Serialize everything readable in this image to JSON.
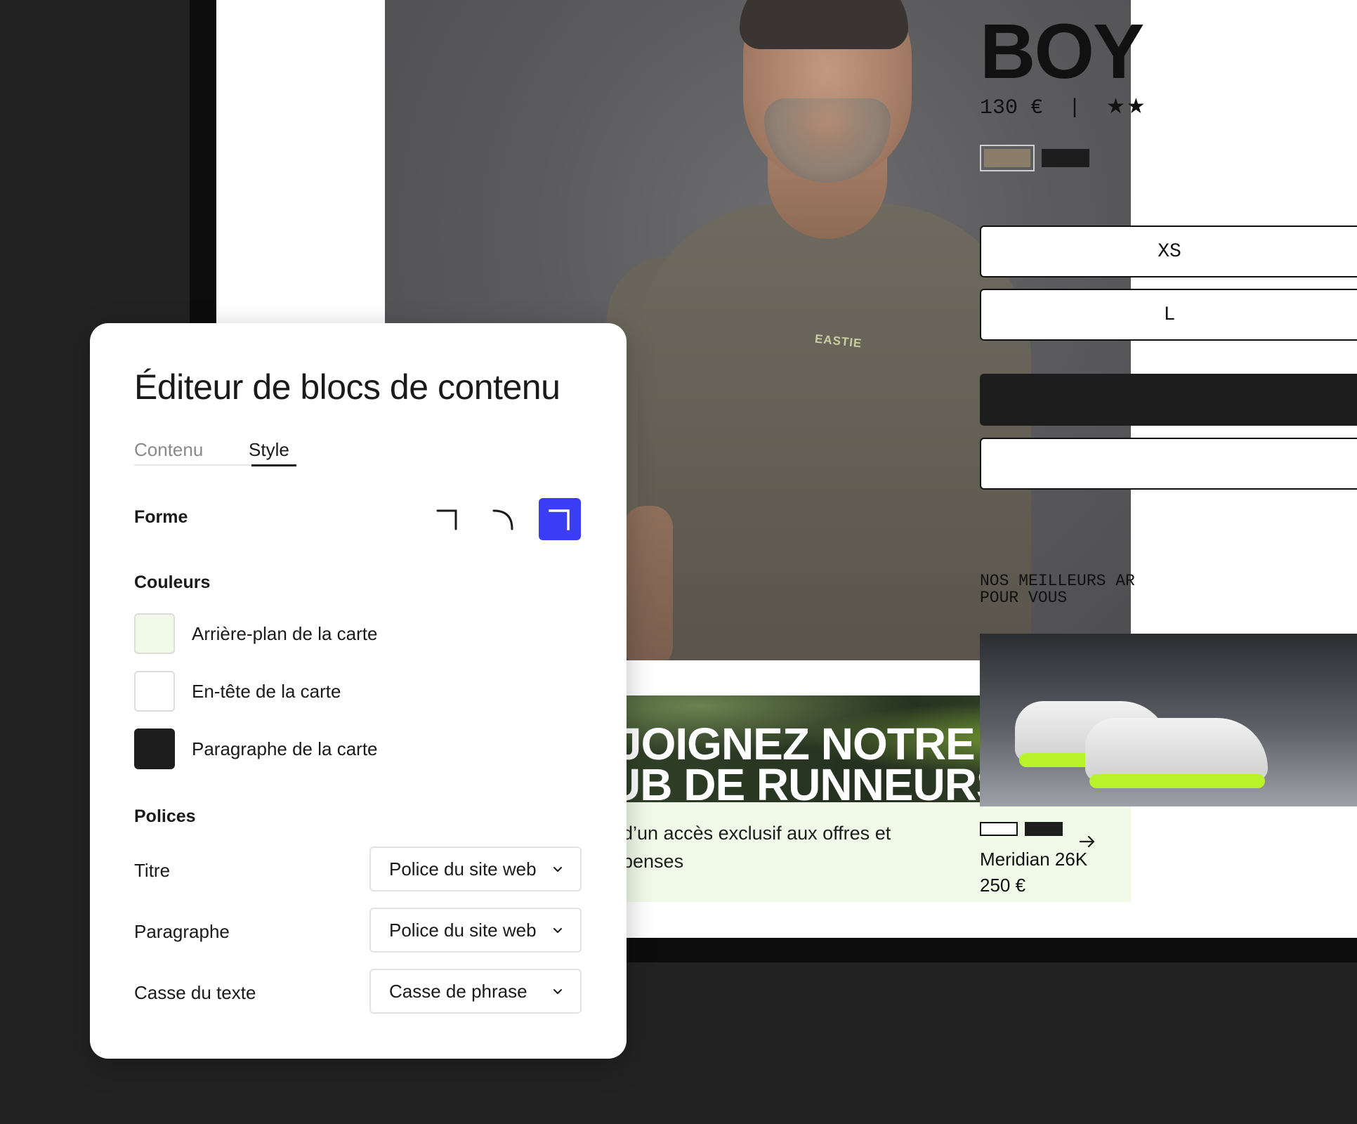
{
  "product": {
    "title": "BOY",
    "price": "130 €",
    "separator": "|",
    "stars": "★★",
    "swatches": [
      "#8a7e6b",
      "#1d1d1d"
    ],
    "sizes": [
      "XS",
      "L"
    ]
  },
  "hero": {
    "shirt_logo": "EASTIE"
  },
  "promo": {
    "title_line1": "JOIGNEZ NOTRE",
    "title_line2": "UB DE RUNNEURS",
    "text_line1": "d’un accès exclusif aux offres et",
    "text_line2": "penses",
    "arrow_icon": "arrow-right-icon"
  },
  "recommendations": {
    "heading": "NOS MEILLEURS AR\nPOUR VOUS",
    "item_name": "Meridian 26K",
    "item_price": "250 €",
    "swatches": [
      "#ffffff",
      "#1d1d1d"
    ]
  },
  "editor": {
    "title": "Éditeur de blocs de contenu",
    "tabs": [
      {
        "label": "Contenu",
        "active": false
      },
      {
        "label": "Style",
        "active": true
      }
    ],
    "shape": {
      "label": "Forme",
      "options": [
        "square-corner-icon",
        "rounded-corner-icon",
        "square-corner-icon"
      ],
      "selected_index": 2,
      "accent": "#3b3df5"
    },
    "colors": {
      "label": "Couleurs",
      "items": [
        {
          "label": "Arrière-plan de la carte",
          "color": "#f1fae9"
        },
        {
          "label": "En-tête de la carte",
          "color": "#ffffff"
        },
        {
          "label": "Paragraphe de la carte",
          "color": "#1d1d1d"
        }
      ]
    },
    "fonts": {
      "label": "Polices",
      "rows": [
        {
          "label": "Titre",
          "value": "Police du site web"
        },
        {
          "label": "Paragraphe",
          "value": "Police du site web"
        },
        {
          "label": "Casse du texte",
          "value": "Casse de phrase"
        }
      ]
    }
  }
}
